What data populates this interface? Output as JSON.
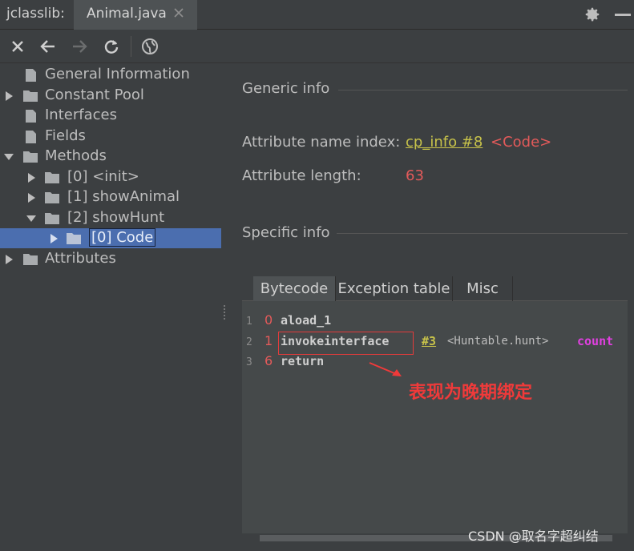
{
  "titlebar": {
    "app_label": "jclasslib:",
    "tab_label": "Animal.java",
    "icons": [
      "close-icon",
      "gear-icon",
      "minimize-icon"
    ]
  },
  "toolbar": {
    "icons": [
      "close-icon",
      "back-arrow-icon",
      "forward-arrow-icon",
      "refresh-icon",
      "globe-icon"
    ]
  },
  "tree": {
    "items": [
      {
        "label": "General Information",
        "depth": 0,
        "expander": "none",
        "icon": "file-icon"
      },
      {
        "label": "Constant Pool",
        "depth": 0,
        "expander": "collapsed",
        "icon": "folder-icon"
      },
      {
        "label": "Interfaces",
        "depth": 0,
        "expander": "none",
        "icon": "file-icon"
      },
      {
        "label": "Fields",
        "depth": 0,
        "expander": "none",
        "icon": "file-icon"
      },
      {
        "label": "Methods",
        "depth": 0,
        "expander": "expanded",
        "icon": "folder-icon"
      },
      {
        "label": "[0] <init>",
        "depth": 1,
        "expander": "collapsed",
        "icon": "folder-icon"
      },
      {
        "label": "[1] showAnimal",
        "depth": 1,
        "expander": "collapsed",
        "icon": "folder-icon"
      },
      {
        "label": "[2] showHunt",
        "depth": 1,
        "expander": "expanded",
        "icon": "folder-icon"
      },
      {
        "label": "[0] Code",
        "depth": 2,
        "expander": "collapsed",
        "icon": "folder-icon",
        "selected": true
      },
      {
        "label": "Attributes",
        "depth": 0,
        "expander": "collapsed",
        "icon": "folder-icon"
      }
    ]
  },
  "generic_info": {
    "title": "Generic info",
    "name_index_label": "Attribute name index:",
    "name_index_link": "cp_info #8",
    "name_index_value": "<Code>",
    "length_label": "Attribute length:",
    "length_value": "63"
  },
  "specific_info": {
    "title": "Specific info",
    "tabs": [
      {
        "label": "Bytecode",
        "active": true
      },
      {
        "label": "Exception table",
        "active": false
      },
      {
        "label": "Misc",
        "active": false
      }
    ]
  },
  "bytecode": {
    "lines": [
      {
        "line": "1",
        "offset": "0",
        "instruction": "aload_1"
      },
      {
        "line": "2",
        "offset": "1",
        "instruction": "invokeinterface",
        "ref": "#3",
        "comment": "<Huntable.hunt>",
        "keyword": "count"
      },
      {
        "line": "3",
        "offset": "6",
        "instruction": "return"
      }
    ]
  },
  "annotation": {
    "text": "表现为晚期绑定",
    "color": "#f03a3a"
  },
  "watermark": "CSDN @取名字超纠结",
  "colors": {
    "background": "#3c3f41",
    "selection": "#4b6eaf",
    "link": "#c7c24a",
    "value": "#e35a5a",
    "keyword": "#e040e0"
  }
}
